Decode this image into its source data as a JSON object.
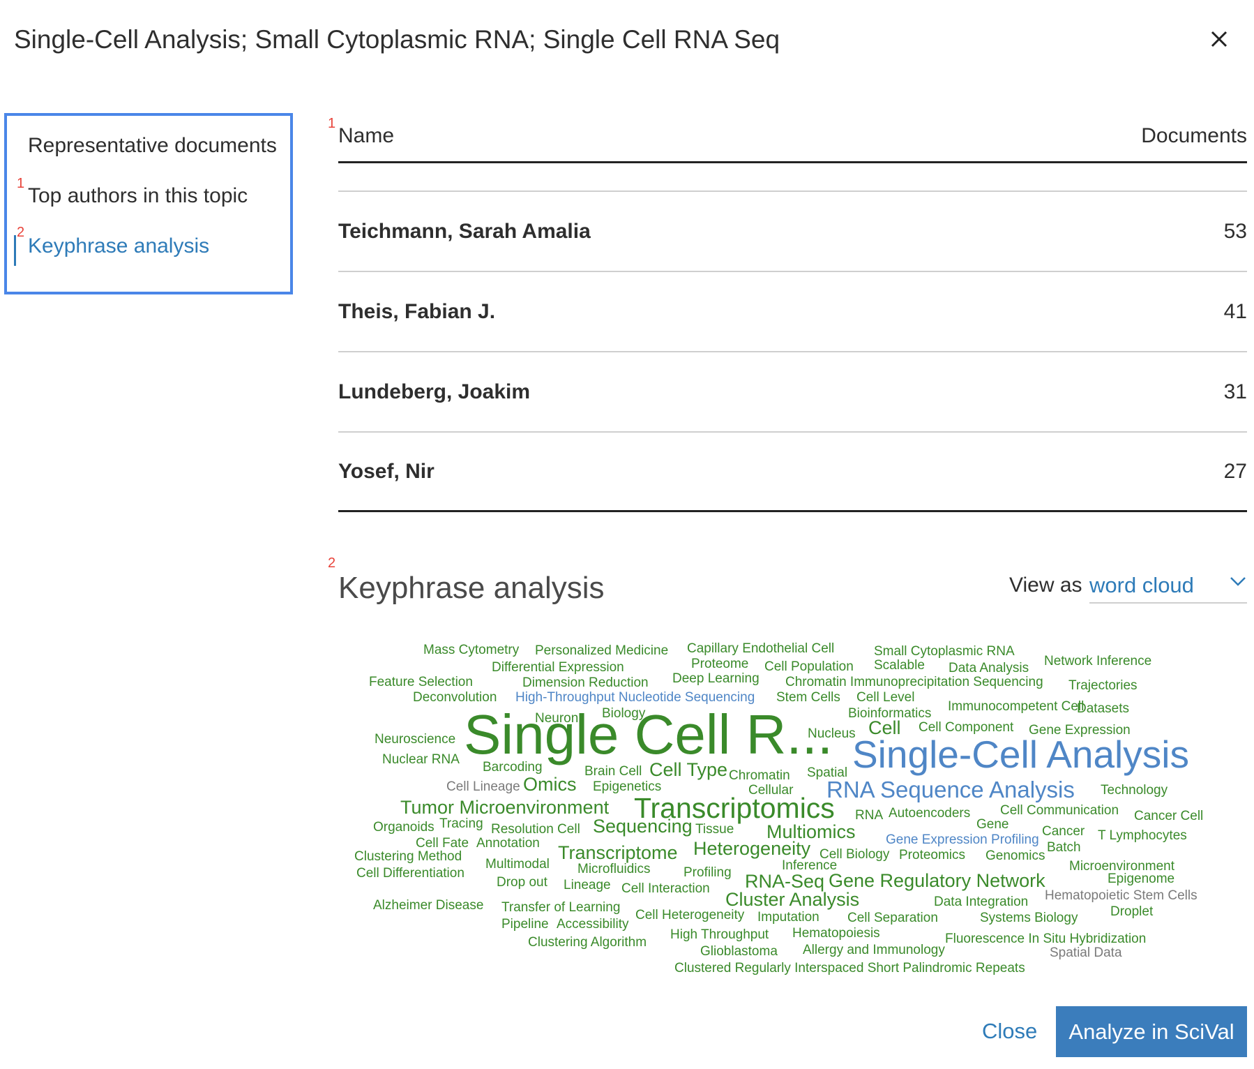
{
  "dialog": {
    "title": "Single-Cell Analysis; Small Cytoplasmic RNA; Single Cell RNA Seq",
    "close_icon": "close-icon"
  },
  "sidebar": {
    "items": [
      {
        "label": "Representative documents",
        "marker": ""
      },
      {
        "label": "Top authors in this topic",
        "marker": "1"
      },
      {
        "label": "Keyphrase analysis",
        "marker": "2"
      }
    ],
    "active_index": 2
  },
  "authors": {
    "marker": "1",
    "col_name": "Name",
    "col_docs": "Documents",
    "rows": [
      {
        "name": "Teichmann, Sarah Amalia",
        "count": "53"
      },
      {
        "name": "Theis, Fabian J.",
        "count": "41"
      },
      {
        "name": "Lundeberg, Joakim",
        "count": "31"
      },
      {
        "name": "Yosef, Nir",
        "count": "27"
      }
    ]
  },
  "keyphrase": {
    "marker": "2",
    "title": "Keyphrase analysis",
    "view_as_label": "View as",
    "view_as_value": "word cloud",
    "dropdown_icon": "chevron-down-icon",
    "words": [
      {
        "t": "Mass Cytometry",
        "c": "green"
      },
      {
        "t": "Personalized Medicine",
        "c": "green"
      },
      {
        "t": "Capillary Endothelial Cell",
        "c": "green"
      },
      {
        "t": "Small Cytoplasmic RNA",
        "c": "green"
      },
      {
        "t": "Network Inference",
        "c": "green"
      },
      {
        "t": "Differential Expression",
        "c": "green"
      },
      {
        "t": "Proteome",
        "c": "green"
      },
      {
        "t": "Cell Population",
        "c": "green"
      },
      {
        "t": "Scalable",
        "c": "green"
      },
      {
        "t": "Data Analysis",
        "c": "green"
      },
      {
        "t": "Feature Selection",
        "c": "green"
      },
      {
        "t": "Dimension Reduction",
        "c": "green"
      },
      {
        "t": "Deep Learning",
        "c": "green"
      },
      {
        "t": "Chromatin Immunoprecipitation Sequencing",
        "c": "green"
      },
      {
        "t": "Trajectories",
        "c": "green"
      },
      {
        "t": "Deconvolution",
        "c": "green"
      },
      {
        "t": "High-Throughput Nucleotide Sequencing",
        "c": "blue"
      },
      {
        "t": "Stem Cells",
        "c": "green"
      },
      {
        "t": "Cell Level",
        "c": "green"
      },
      {
        "t": "Immunocompetent Cell",
        "c": "green"
      },
      {
        "t": "Datasets",
        "c": "green"
      },
      {
        "t": "Neuron",
        "c": "green"
      },
      {
        "t": "Biology",
        "c": "green"
      },
      {
        "t": "Bioinformatics",
        "c": "green"
      },
      {
        "t": "Neuroscience",
        "c": "green"
      },
      {
        "t": "Single Cell R...",
        "c": "green"
      },
      {
        "t": "Nucleus",
        "c": "green"
      },
      {
        "t": "Cell",
        "c": "green"
      },
      {
        "t": "Cell Component",
        "c": "green"
      },
      {
        "t": "Gene Expression",
        "c": "green"
      },
      {
        "t": "Single-Cell Analysis",
        "c": "blue"
      },
      {
        "t": "Nuclear RNA",
        "c": "green"
      },
      {
        "t": "Barcoding",
        "c": "green"
      },
      {
        "t": "Brain Cell",
        "c": "green"
      },
      {
        "t": "Cell Type",
        "c": "green"
      },
      {
        "t": "Chromatin",
        "c": "green"
      },
      {
        "t": "Spatial",
        "c": "green"
      },
      {
        "t": "Cell Lineage",
        "c": "gray"
      },
      {
        "t": "Omics",
        "c": "green"
      },
      {
        "t": "Epigenetics",
        "c": "green"
      },
      {
        "t": "Cellular",
        "c": "green"
      },
      {
        "t": "RNA Sequence Analysis",
        "c": "blue"
      },
      {
        "t": "Technology",
        "c": "green"
      },
      {
        "t": "Tumor Microenvironment",
        "c": "green"
      },
      {
        "t": "Transcriptomics",
        "c": "green"
      },
      {
        "t": "RNA",
        "c": "green"
      },
      {
        "t": "Autoencoders",
        "c": "green"
      },
      {
        "t": "Cell Communication",
        "c": "green"
      },
      {
        "t": "Cancer Cell",
        "c": "green"
      },
      {
        "t": "Organoids",
        "c": "green"
      },
      {
        "t": "Tracing",
        "c": "green"
      },
      {
        "t": "Resolution Cell",
        "c": "green"
      },
      {
        "t": "Sequencing",
        "c": "green"
      },
      {
        "t": "Tissue",
        "c": "green"
      },
      {
        "t": "Multiomics",
        "c": "green"
      },
      {
        "t": "Gene",
        "c": "green"
      },
      {
        "t": "Cancer",
        "c": "green"
      },
      {
        "t": "T Lymphocytes",
        "c": "green"
      },
      {
        "t": "Cell Fate",
        "c": "green"
      },
      {
        "t": "Annotation",
        "c": "green"
      },
      {
        "t": "Gene Expression Profiling",
        "c": "blue"
      },
      {
        "t": "Batch",
        "c": "green"
      },
      {
        "t": "Heterogeneity",
        "c": "green"
      },
      {
        "t": "Clustering Method",
        "c": "green"
      },
      {
        "t": "Transcriptome",
        "c": "green"
      },
      {
        "t": "Cell Biology",
        "c": "green"
      },
      {
        "t": "Proteomics",
        "c": "green"
      },
      {
        "t": "Genomics",
        "c": "green"
      },
      {
        "t": "Multimodal",
        "c": "green"
      },
      {
        "t": "Inference",
        "c": "green"
      },
      {
        "t": "Microenvironment",
        "c": "green"
      },
      {
        "t": "Cell Differentiation",
        "c": "green"
      },
      {
        "t": "Microfluidics",
        "c": "green"
      },
      {
        "t": "Profiling",
        "c": "green"
      },
      {
        "t": "Epigenome",
        "c": "green"
      },
      {
        "t": "Drop out",
        "c": "green"
      },
      {
        "t": "Lineage",
        "c": "green"
      },
      {
        "t": "Cell Interaction",
        "c": "green"
      },
      {
        "t": "RNA-Seq",
        "c": "green"
      },
      {
        "t": "Gene Regulatory Network",
        "c": "green"
      },
      {
        "t": "Hematopoietic Stem Cells",
        "c": "gray"
      },
      {
        "t": "Alzheimer Disease",
        "c": "green"
      },
      {
        "t": "Cluster Analysis",
        "c": "green"
      },
      {
        "t": "Data Integration",
        "c": "green"
      },
      {
        "t": "Transfer of Learning",
        "c": "green"
      },
      {
        "t": "Droplet",
        "c": "green"
      },
      {
        "t": "Cell Heterogeneity",
        "c": "green"
      },
      {
        "t": "Imputation",
        "c": "green"
      },
      {
        "t": "Cell Separation",
        "c": "green"
      },
      {
        "t": "Systems Biology",
        "c": "green"
      },
      {
        "t": "Pipeline",
        "c": "green"
      },
      {
        "t": "Accessibility",
        "c": "green"
      },
      {
        "t": "High Throughput",
        "c": "green"
      },
      {
        "t": "Hematopoiesis",
        "c": "green"
      },
      {
        "t": "Fluorescence In Situ Hybridization",
        "c": "green"
      },
      {
        "t": "Clustering Algorithm",
        "c": "green"
      },
      {
        "t": "Glioblastoma",
        "c": "green"
      },
      {
        "t": "Allergy and Immunology",
        "c": "green"
      },
      {
        "t": "Spatial Data",
        "c": "gray"
      },
      {
        "t": "Clustered Regularly Interspaced Short Palindromic Repeats",
        "c": "green"
      }
    ]
  },
  "footer": {
    "close_label": "Close",
    "analyze_label": "Analyze in SciVal"
  },
  "colors": {
    "accent": "#2e7bb8",
    "focus_border": "#4a86e8",
    "cloud_green": "#3a8a2a",
    "cloud_blue": "#4f86c6",
    "cloud_gray": "#7a7a7a",
    "marker_red": "#e8433a"
  }
}
